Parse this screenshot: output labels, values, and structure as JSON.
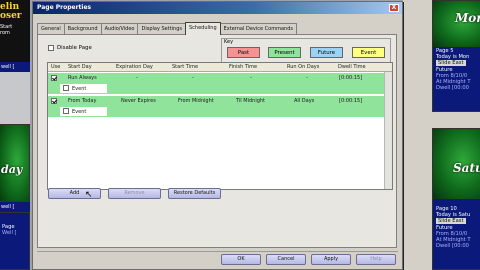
{
  "background": {
    "top_left": {
      "line1": "elin",
      "line2": "oser",
      "sub1": "Start",
      "sub2": "rom",
      "bar": "well ["
    },
    "middle_left": {
      "script": "day",
      "bar": "well ["
    },
    "bottom_left": {
      "sub1": "Page",
      "sub2": "Well ["
    },
    "top_right": {
      "script": "Mon",
      "lines": [
        "Page 5",
        "Today is Mon",
        "Slide East",
        "Future",
        "From 8/10/0",
        "At Midnight T",
        "Dwell [00:00"
      ]
    },
    "bottom_right": {
      "script": "Satu",
      "lines": [
        "Page 10",
        "Today is Satu",
        "Slide East",
        "Future",
        "From 8/10/0",
        "At Midnight T",
        "Dwell [00:00"
      ]
    }
  },
  "dialog": {
    "title": "Page Properties",
    "close_glyph": "X",
    "tabs": [
      "General",
      "Background",
      "Audio/Video",
      "Display Settings",
      "Scheduling",
      "External Device Commands"
    ],
    "active_tab": "Scheduling",
    "disable_page_label": "Disable Page",
    "key": {
      "label": "Key",
      "items": [
        {
          "label": "Past",
          "color": "#f59393"
        },
        {
          "label": "Present",
          "color": "#8fe39b"
        },
        {
          "label": "Future",
          "color": "#9bd3f5"
        },
        {
          "label": "Event",
          "color": "#ffff80"
        }
      ]
    },
    "grid": {
      "headers": [
        "Use",
        "Start Day",
        "Expiration Day",
        "Start Time",
        "Finish Time",
        "Run On Days",
        "Dwell Time"
      ],
      "rows": [
        {
          "use": true,
          "start_day": "Run Always",
          "expiration_day": "-",
          "start_time": "-",
          "finish_time": "-",
          "run_on_days": "-",
          "dwell_time": "[0:00:15]",
          "event_checked": false,
          "event_label": "Event"
        },
        {
          "use": true,
          "start_day": "From Today",
          "expiration_day": "Never Expires",
          "start_time": "From Midnight",
          "finish_time": "Til Midnight",
          "run_on_days": "All Days",
          "dwell_time": "[0:00:15]",
          "event_checked": false,
          "event_label": "Event"
        }
      ]
    },
    "buttons": {
      "add": "Add",
      "remove": "Remove",
      "restore_defaults": "Restore Defaults",
      "ok": "OK",
      "cancel": "Cancel",
      "apply": "Apply",
      "help": "Help"
    }
  }
}
